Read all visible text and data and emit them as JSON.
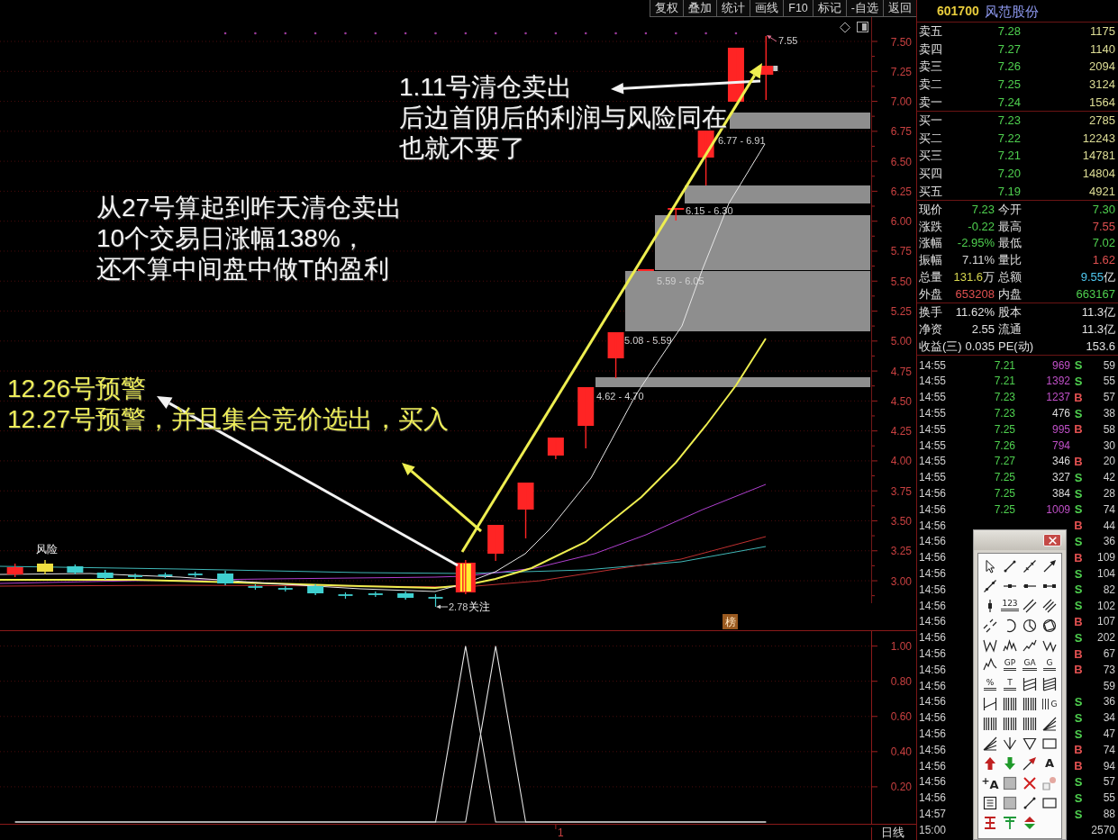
{
  "toolbar": {
    "buttons": [
      "复权",
      "叠加",
      "统计",
      "画线",
      "F10",
      "标记",
      "-自选",
      "返回"
    ]
  },
  "price_chart": {
    "axis_labels": [
      "7.50",
      "7.25",
      "7.00",
      "6.75",
      "6.50",
      "6.25",
      "6.00",
      "5.75",
      "5.50",
      "5.25",
      "5.00",
      "4.75",
      "4.50",
      "4.25",
      "4.00",
      "3.75",
      "3.50",
      "3.25",
      "3.00"
    ],
    "high_label": "7.55",
    "low_label": "2.78",
    "low_note": "关注",
    "risk_label": "风险",
    "badge": "榜",
    "gaps": [
      {
        "label": "6.77 - 6.91"
      },
      {
        "label": "6.15 - 6.30"
      },
      {
        "label": "5.59 - 6.05"
      },
      {
        "label": "5.08 - 5.59"
      },
      {
        "label": "4.62 - 4.70"
      }
    ],
    "annotations": [
      {
        "color": "#f4f4f4",
        "lines": [
          "1.11号清仓卖出",
          "后边首阴后的利润与风险同在",
          "也就不要了"
        ]
      },
      {
        "color": "#f4f4f4",
        "lines": [
          "从27号算起到昨天清仓卖出",
          "10个交易日涨幅138%，",
          "还不算中间盘中做T的盈利"
        ]
      },
      {
        "color": "#eeee5a",
        "lines": [
          "12.26号预警",
          "12.27号预警，并且集合竞价选出，买入"
        ]
      }
    ]
  },
  "indicator": {
    "chart_data": {
      "type": "line",
      "grid": true,
      "ylim": [
        0,
        1.09
      ],
      "yticks": [
        {
          "value": 0.2,
          "label": "0.20"
        },
        {
          "value": 0.4,
          "label": "0.40"
        },
        {
          "value": 0.6,
          "label": "0.60"
        },
        {
          "value": 0.8,
          "label": "0.80"
        },
        {
          "value": 1,
          "label": "1.00"
        }
      ],
      "series": [
        {
          "values": [
            0,
            0,
            0,
            0,
            0,
            0,
            0,
            0,
            0,
            0,
            0,
            0,
            0,
            0,
            0,
            1,
            0,
            0,
            0,
            0,
            0,
            0,
            0,
            0,
            0,
            0,
            null,
            null,
            null
          ]
        },
        {
          "values": [
            0,
            0,
            0,
            0,
            0,
            0,
            0,
            0,
            0,
            0,
            0,
            0,
            0,
            0,
            0,
            0,
            1,
            0,
            0,
            0,
            0,
            0,
            0,
            0,
            0,
            0,
            null,
            null,
            null
          ]
        }
      ]
    },
    "date_marker": "1"
  },
  "period_label": "日线",
  "stock": {
    "code": "601700",
    "name": "风范股份"
  },
  "order_book": {
    "asks": [
      {
        "label": "卖五",
        "price": "7.28",
        "volume": "1175"
      },
      {
        "label": "卖四",
        "price": "7.27",
        "volume": "1140"
      },
      {
        "label": "卖三",
        "price": "7.26",
        "volume": "2094"
      },
      {
        "label": "卖二",
        "price": "7.25",
        "volume": "3124"
      },
      {
        "label": "卖一",
        "price": "7.24",
        "volume": "1564"
      }
    ],
    "bids": [
      {
        "label": "买一",
        "price": "7.23",
        "volume": "2785"
      },
      {
        "label": "买二",
        "price": "7.22",
        "volume": "12243"
      },
      {
        "label": "买三",
        "price": "7.21",
        "volume": "14781"
      },
      {
        "label": "买四",
        "price": "7.20",
        "volume": "14804"
      },
      {
        "label": "买五",
        "price": "7.19",
        "volume": "4921"
      }
    ]
  },
  "quote": {
    "rows": [
      {
        "cells": [
          {
            "label": "现价",
            "value": "7.23",
            "color": "#4fd04f"
          },
          {
            "label": "今开",
            "value": "7.30",
            "color": "#4fd04f"
          }
        ]
      },
      {
        "cells": [
          {
            "label": "涨跌",
            "value": "-0.22",
            "color": "#4fd04f"
          },
          {
            "label": "最高",
            "value": "7.55",
            "color": "#e05050"
          }
        ]
      },
      {
        "cells": [
          {
            "label": "涨幅",
            "value": "-2.95%",
            "color": "#4fd04f"
          },
          {
            "label": "最低",
            "value": "7.02",
            "color": "#4fd04f"
          }
        ]
      },
      {
        "cells": [
          {
            "label": "振幅",
            "value": "7.11%",
            "color": "#d8d8d8"
          },
          {
            "label": "量比",
            "value": "1.62",
            "color": "#e05050"
          }
        ]
      },
      {
        "cells": [
          {
            "label": "总量",
            "value": "131.6",
            "unit": "万",
            "color": "#d8d850"
          },
          {
            "label": "总额",
            "value": "9.55",
            "unit": "亿",
            "color": "#4fc8f0"
          }
        ]
      },
      {
        "cells": [
          {
            "label": "外盘",
            "value": "653208",
            "color": "#e05050"
          },
          {
            "label": "内盘",
            "value": "663167",
            "color": "#4fd04f"
          }
        ]
      }
    ]
  },
  "fundamentals": {
    "rows": [
      {
        "cells": [
          {
            "label": "换手",
            "value": "11.62%"
          },
          {
            "label": "股本",
            "value": "11.3亿"
          }
        ]
      },
      {
        "cells": [
          {
            "label": "净资",
            "value": "2.55"
          },
          {
            "label": "流通",
            "value": "11.3亿"
          }
        ]
      },
      {
        "cells": [
          {
            "label": "收益(三)",
            "value": "0.035"
          },
          {
            "label": "PE(动)",
            "value": "153.6"
          }
        ]
      }
    ]
  },
  "ticks": [
    {
      "time": "14:55",
      "price": "7.21",
      "volume": "969",
      "big": true,
      "flag": "S",
      "buy": false,
      "count": "59"
    },
    {
      "time": "14:55",
      "price": "7.21",
      "volume": "1392",
      "big": true,
      "flag": "S",
      "buy": false,
      "count": "55"
    },
    {
      "time": "14:55",
      "price": "7.23",
      "volume": "1237",
      "big": true,
      "flag": "B",
      "buy": true,
      "count": "57"
    },
    {
      "time": "14:55",
      "price": "7.23",
      "volume": "476",
      "big": false,
      "flag": "S",
      "buy": false,
      "count": "38"
    },
    {
      "time": "14:55",
      "price": "7.25",
      "volume": "995",
      "big": true,
      "flag": "B",
      "buy": true,
      "count": "58"
    },
    {
      "time": "14:55",
      "price": "7.26",
      "volume": "794",
      "big": true,
      "count": "30"
    },
    {
      "time": "14:55",
      "price": "7.27",
      "volume": "346",
      "big": false,
      "flag": "B",
      "buy": true,
      "count": "20"
    },
    {
      "time": "14:55",
      "price": "7.25",
      "volume": "327",
      "big": false,
      "flag": "S",
      "buy": false,
      "count": "42"
    },
    {
      "time": "14:56",
      "price": "7.25",
      "volume": "384",
      "big": false,
      "flag": "S",
      "buy": false,
      "count": "28"
    },
    {
      "time": "14:56",
      "price": "7.25",
      "volume": "1009",
      "big": true,
      "flag": "S",
      "buy": false,
      "count": "74"
    },
    {
      "time": "14:56",
      "flag": "B",
      "buy": true,
      "count": "44"
    },
    {
      "time": "14:56",
      "flag": "S",
      "buy": false,
      "count": "36"
    },
    {
      "time": "14:56",
      "flag": "B",
      "buy": true,
      "count": "109"
    },
    {
      "time": "14:56",
      "flag": "S",
      "buy": false,
      "count": "104"
    },
    {
      "time": "14:56",
      "flag": "S",
      "buy": false,
      "count": "82"
    },
    {
      "time": "14:56",
      "flag": "S",
      "buy": false,
      "count": "102"
    },
    {
      "time": "14:56",
      "flag": "B",
      "buy": true,
      "count": "107"
    },
    {
      "time": "14:56",
      "flag": "S",
      "buy": false,
      "count": "202"
    },
    {
      "time": "14:56",
      "flag": "B",
      "buy": true,
      "count": "67"
    },
    {
      "time": "14:56",
      "flag": "B",
      "buy": true,
      "count": "73"
    },
    {
      "time": "14:56",
      "count": "59"
    },
    {
      "time": "14:56",
      "flag": "S",
      "buy": false,
      "count": "36"
    },
    {
      "time": "14:56",
      "flag": "S",
      "buy": false,
      "count": "34"
    },
    {
      "time": "14:56",
      "flag": "S",
      "buy": false,
      "count": "47"
    },
    {
      "time": "14:56",
      "flag": "B",
      "buy": true,
      "count": "74"
    },
    {
      "time": "14:56",
      "flag": "B",
      "buy": true,
      "count": "94"
    },
    {
      "time": "14:56",
      "flag": "S",
      "buy": false,
      "count": "57"
    },
    {
      "time": "14:56",
      "flag": "S",
      "buy": false,
      "count": "55"
    },
    {
      "time": "14:57",
      "flag": "S",
      "buy": false,
      "count": "88"
    },
    {
      "time": "15:00",
      "count": "2570"
    }
  ],
  "toolbox": {
    "tools": [
      {
        "kind": "cursor"
      },
      {
        "kind": "segment"
      },
      {
        "kind": "ray"
      },
      {
        "kind": "arrow-line"
      },
      {
        "kind": "line"
      },
      {
        "kind": "dot-segment"
      },
      {
        "kind": "h-ray"
      },
      {
        "kind": "h-segment"
      },
      {
        "kind": "v-line"
      },
      {
        "kind": "text-lines",
        "label": "123"
      },
      {
        "kind": "parallel"
      },
      {
        "kind": "parallel3"
      },
      {
        "kind": "dashed-pair"
      },
      {
        "kind": "arc"
      },
      {
        "kind": "circle-cross"
      },
      {
        "kind": "circle-poly"
      },
      {
        "kind": "zigzag"
      },
      {
        "kind": "spikes"
      },
      {
        "kind": "rising"
      },
      {
        "kind": "zigzag-n"
      },
      {
        "kind": "peaks"
      },
      {
        "kind": "text-lines",
        "label": "GP"
      },
      {
        "kind": "text-lines",
        "label": "GA"
      },
      {
        "kind": "text-lines",
        "label": "G"
      },
      {
        "kind": "text-lines",
        "label": "%"
      },
      {
        "kind": "text-lines",
        "label": "T"
      },
      {
        "kind": "hatch"
      },
      {
        "kind": "hatch2"
      },
      {
        "kind": "bracket"
      },
      {
        "kind": "bars"
      },
      {
        "kind": "bars"
      },
      {
        "kind": "bars-text",
        "label": "G"
      },
      {
        "kind": "bars"
      },
      {
        "kind": "bars"
      },
      {
        "kind": "bars"
      },
      {
        "kind": "fan"
      },
      {
        "kind": "fan"
      },
      {
        "kind": "chevron"
      },
      {
        "kind": "triangle"
      },
      {
        "kind": "rectangle"
      },
      {
        "kind": "up-arrow"
      },
      {
        "kind": "down-arrow"
      },
      {
        "kind": "diag-arrow"
      },
      {
        "kind": "letter",
        "label": "A"
      },
      {
        "kind": "letter",
        "label": "$^{+}$A"
      },
      {
        "kind": "square"
      },
      {
        "kind": "x-mark"
      },
      {
        "kind": "eraser"
      },
      {
        "kind": "frame"
      },
      {
        "kind": "square"
      },
      {
        "kind": "segment"
      },
      {
        "kind": "rectangle"
      },
      {
        "kind": "i-beam"
      },
      {
        "kind": "tee"
      },
      {
        "kind": "up-down"
      }
    ]
  }
}
